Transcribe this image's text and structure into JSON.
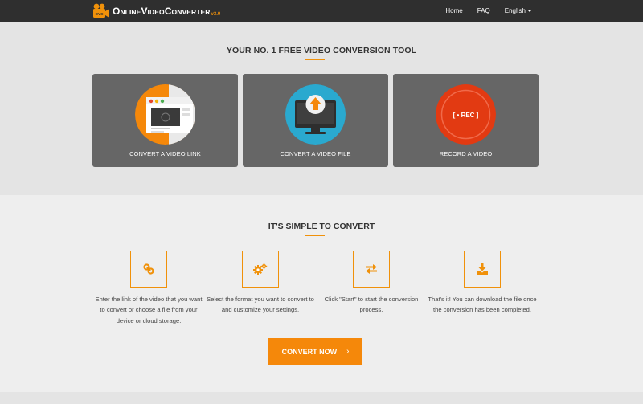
{
  "header": {
    "logo_prefix": "O",
    "logo_text_1": "NLINE",
    "logo_prefix_2": "V",
    "logo_text_2": "IDEO",
    "logo_prefix_3": "C",
    "logo_text_3": "ONVERTER",
    "logo_version": "v3.0",
    "logo_badge": "OVC",
    "nav": [
      {
        "label": "Home"
      },
      {
        "label": "FAQ"
      },
      {
        "label": "English"
      }
    ]
  },
  "hero": {
    "title": "YOUR NO. 1 FREE VIDEO CONVERSION TOOL",
    "cards": [
      {
        "label": "CONVERT A VIDEO LINK",
        "icon": "browser-video-icon",
        "color": "#f5880a"
      },
      {
        "label": "CONVERT A VIDEO FILE",
        "icon": "monitor-upload-icon",
        "color": "#2aa9cf"
      },
      {
        "label": "RECORD A VIDEO",
        "icon": "record-icon",
        "color": "#e23a12",
        "badge": "[ • REC ]"
      }
    ]
  },
  "simple": {
    "title": "IT'S SIMPLE TO CONVERT",
    "steps": [
      {
        "icon": "link-icon",
        "text": "Enter the link of the video that you want to convert or choose a file from your device or cloud storage."
      },
      {
        "icon": "gears-icon",
        "text": "Select the format you want to convert to and customize your settings."
      },
      {
        "icon": "exchange-icon",
        "text": "Click \"Start\" to start the conversion process."
      },
      {
        "icon": "download-icon",
        "text": "That's it! You can download the file once the conversion has been completed."
      }
    ],
    "cta_label": "CONVERT NOW",
    "cta_chevron": "›"
  },
  "colors": {
    "accent": "#f5880a",
    "header_bg": "#2f2f2f",
    "card_bg": "#666666"
  }
}
